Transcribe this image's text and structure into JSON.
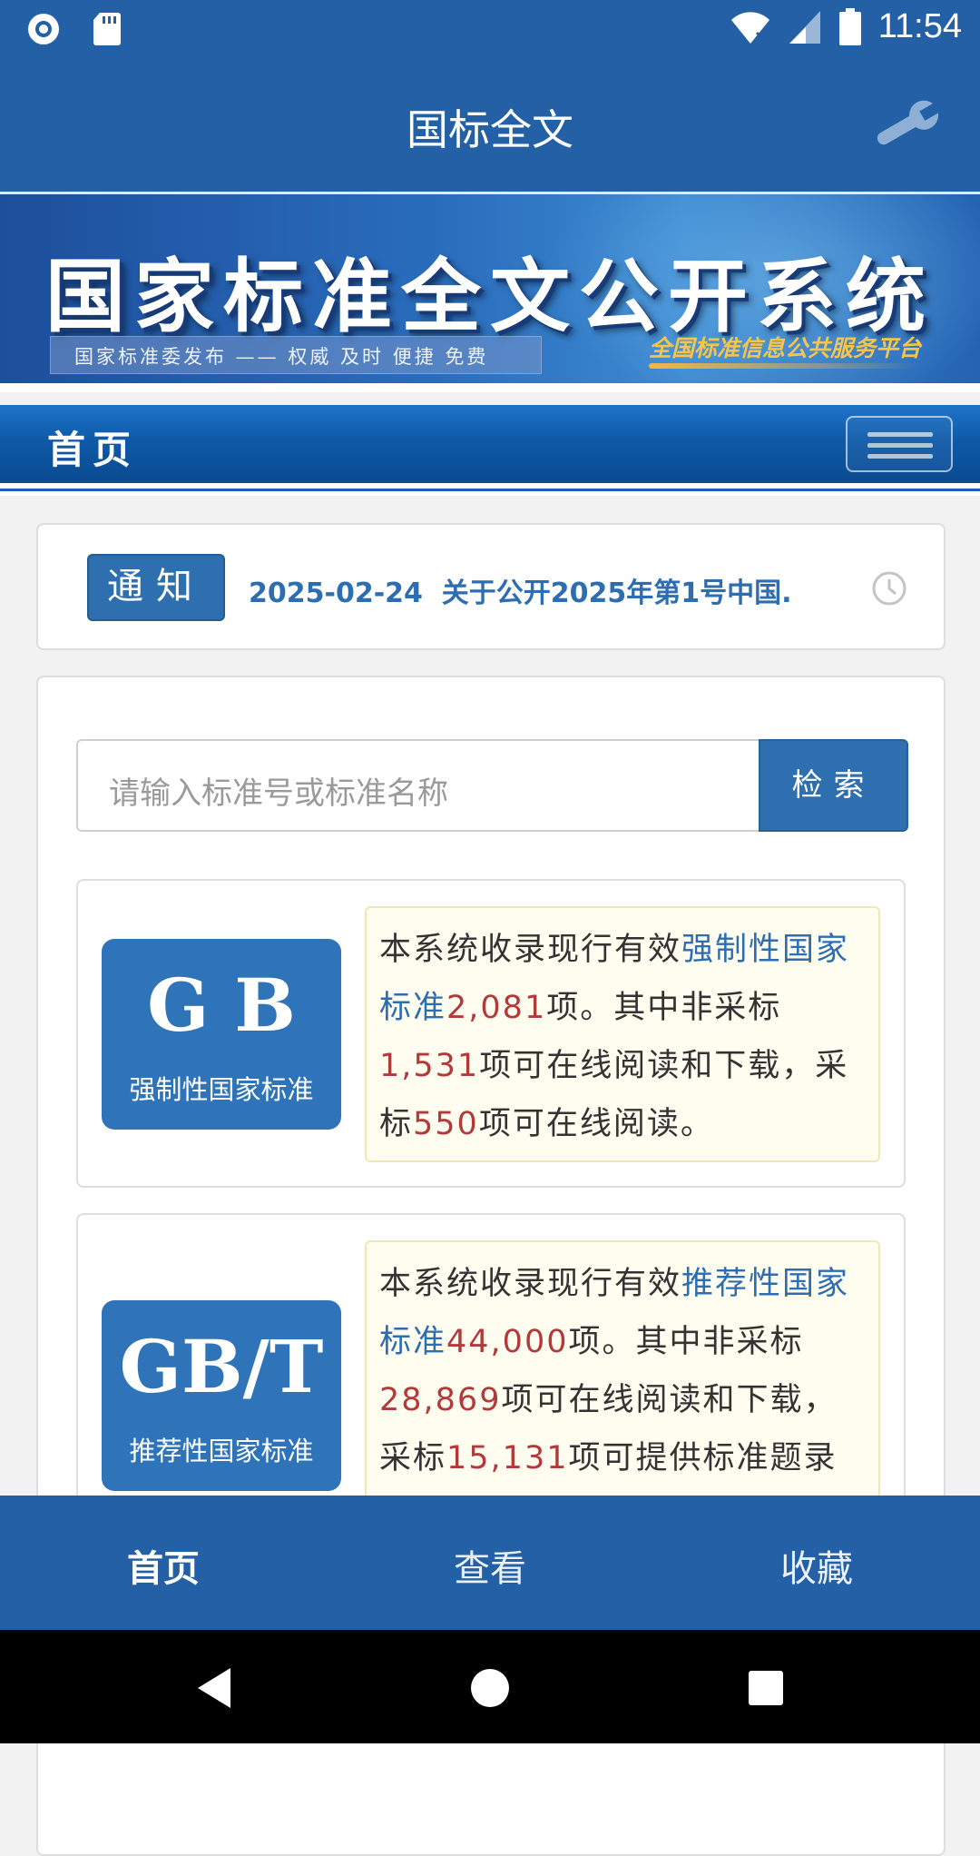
{
  "status_bar": {
    "time": "11:54"
  },
  "app_bar": {
    "title": "国标全文"
  },
  "banner": {
    "title": "国家标准全文公开系统",
    "tagline": "国家标准委发布 —— 权威 及时 便捷 免费",
    "platform": "全国标准信息公共服务平台"
  },
  "nav": {
    "label": "首页"
  },
  "notice": {
    "badge": "通知",
    "date": "2025-02-24",
    "headline": "关于公开2025年第1号中国."
  },
  "search": {
    "placeholder": "请输入标准号或标准名称",
    "button": "检索"
  },
  "standards": [
    {
      "code": "G B",
      "name": "强制性国家标准",
      "desc_prefix": "本系统收录现行有效",
      "desc_type": "强制性国家标准",
      "desc_total": "2,081",
      "desc_mid1": "项。其中非采标",
      "desc_non_adopted": "1,531",
      "desc_mid2": "项可在线阅读和下载，采标",
      "desc_adopted": "550",
      "desc_suffix": "项可在线阅读。"
    },
    {
      "code": "GB/T",
      "name": "推荐性国家标准",
      "desc_prefix": "本系统收录现行有效",
      "desc_type": "推荐性国家标准",
      "desc_total": "44,000",
      "desc_mid1": "项。其中非采标",
      "desc_non_adopted": "28,869",
      "desc_mid2": "项可在线阅读和下载，采标",
      "desc_adopted": "15,131",
      "desc_suffix": "项可提供标准题录信息。"
    }
  ],
  "tabbar": {
    "items": [
      "首页",
      "查看",
      "收藏"
    ]
  },
  "colors": {
    "primary": "#2360a6",
    "accent_text": "#2d6db2",
    "number_red": "#b13a3a",
    "desc_bg": "#fffdf0"
  }
}
